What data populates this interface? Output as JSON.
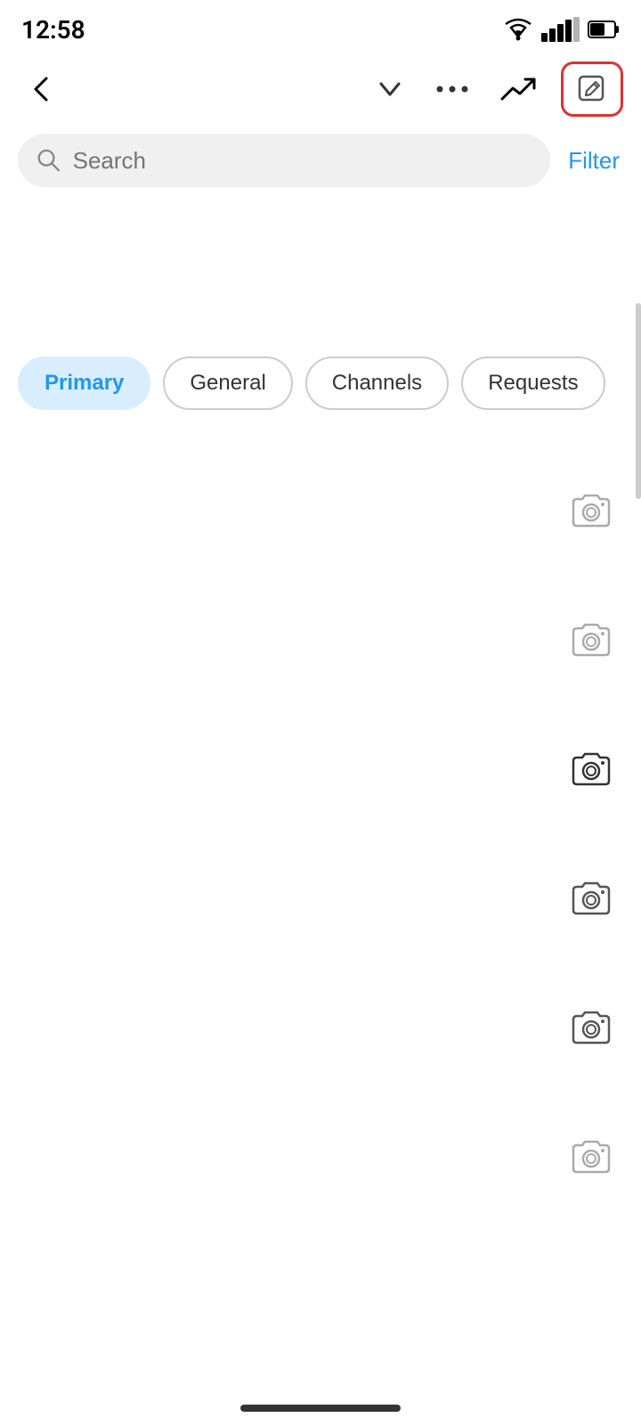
{
  "statusBar": {
    "time": "12:58"
  },
  "toolbar": {
    "backLabel": "←",
    "chevronLabel": "chevron-down",
    "moreLabel": "more",
    "trendingLabel": "trending",
    "composeLabel": "compose"
  },
  "search": {
    "placeholder": "Search",
    "filterLabel": "Filter"
  },
  "tabs": [
    {
      "id": "primary",
      "label": "Primary",
      "active": true
    },
    {
      "id": "general",
      "label": "General",
      "active": false
    },
    {
      "id": "channels",
      "label": "Channels",
      "active": false
    },
    {
      "id": "requests",
      "label": "Requests",
      "active": false
    }
  ],
  "cameraItems": [
    {
      "id": 1
    },
    {
      "id": 2
    },
    {
      "id": 3
    },
    {
      "id": 4
    },
    {
      "id": 5
    },
    {
      "id": 6
    }
  ],
  "colors": {
    "accent": "#2196F3",
    "composeHighlight": "#e03030",
    "tabActive": "#d8eeff"
  }
}
